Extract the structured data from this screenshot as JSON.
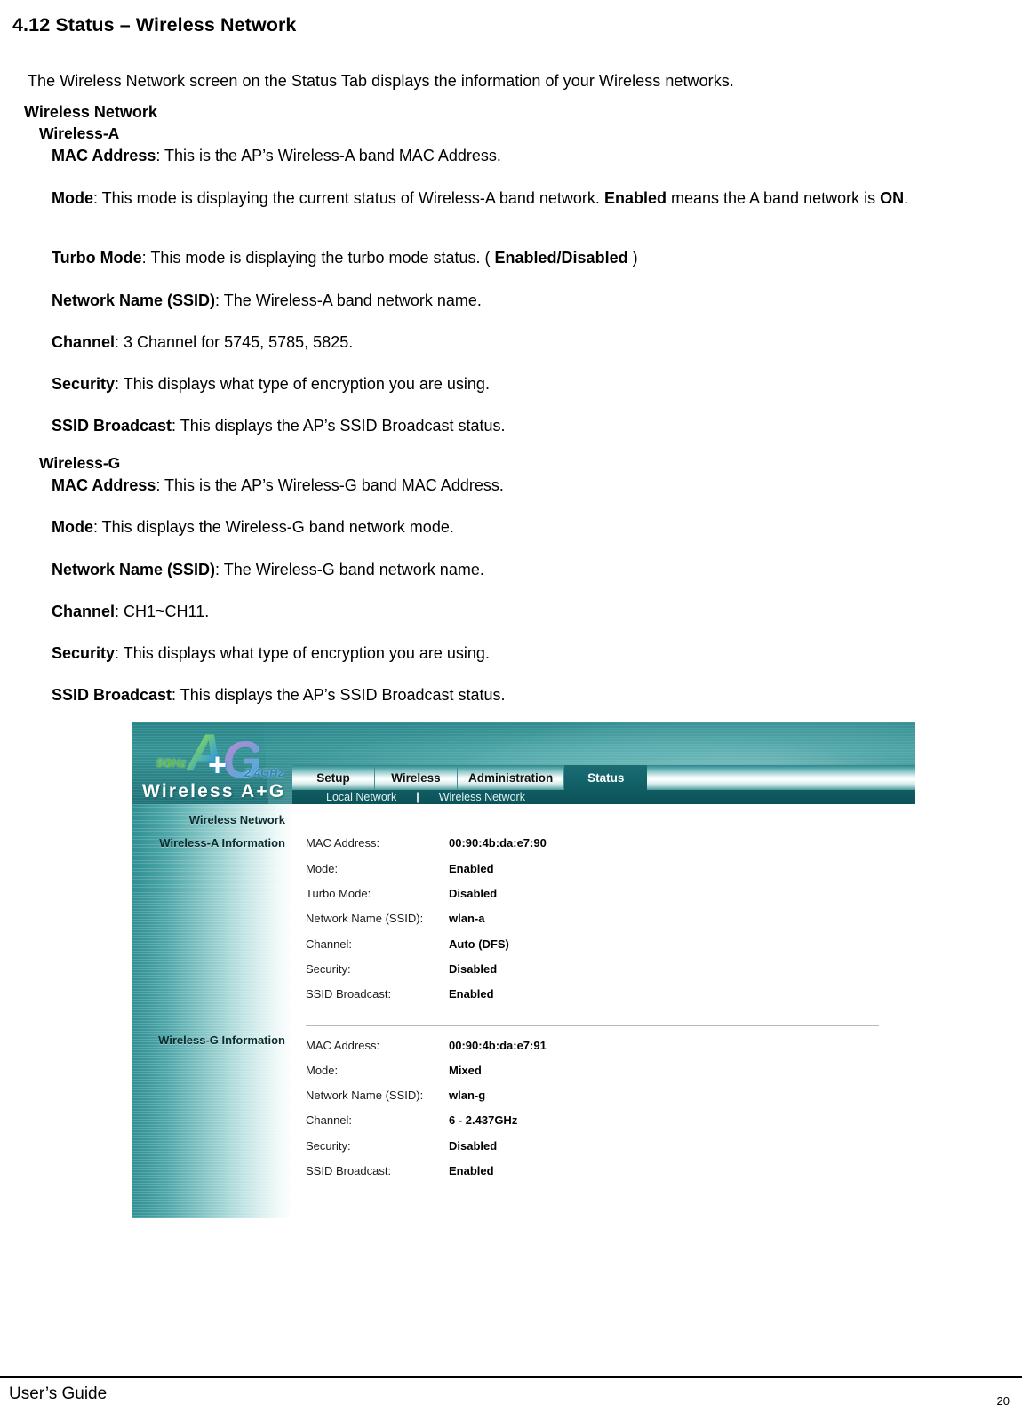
{
  "document": {
    "heading": "4.12 Status – Wireless Network",
    "intro": "The Wireless Network screen on the Status Tab displays the information of your Wireless networks.",
    "section_title": "Wireless Network",
    "subsection_a_title": "Wireless-A",
    "subsection_g_title": "Wireless-G",
    "wireless_a_items": [
      {
        "term": "MAC Address",
        "text": ": This is the AP’s Wireless-A band MAC Address."
      },
      {
        "term": "Mode",
        "text": ": This mode is displaying the current status of Wireless-A band network. ",
        "bold_mid": "Enabled",
        "text2": " means the A band network is ",
        "bold_end": "ON",
        "text3": "."
      },
      {
        "term": "Turbo Mode",
        "text": ": This mode is displaying the turbo mode status. ( ",
        "bold_mid": "Enabled/Disabled",
        "text2": " )"
      },
      {
        "term": "Network Name (SSID)",
        "text": ": The Wireless-A band network name."
      },
      {
        "term": "Channel",
        "text": ": 3 Channel for 5745, 5785, 5825."
      },
      {
        "term": "Security",
        "text": ": This displays what type of encryption you are using."
      },
      {
        "term": "SSID Broadcast",
        "text": ": This displays the AP’s SSID Broadcast status."
      }
    ],
    "wireless_g_items": [
      {
        "term": "MAC Address",
        "text": ": This is the AP’s Wireless-G band MAC Address."
      },
      {
        "term": "Mode",
        "text": ": This displays the Wireless-G band network mode."
      },
      {
        "term": "Network Name (SSID)",
        "text": ": The Wireless-G band network name."
      },
      {
        "term": "Channel",
        "text": ": CH1~CH11."
      },
      {
        "term": "Security",
        "text": ": This displays what type of encryption you are using."
      },
      {
        "term": "SSID Broadcast",
        "text": ": This displays the AP’s SSID Broadcast status."
      }
    ],
    "footer": {
      "left": "User’s Guide",
      "page_number": "20"
    }
  },
  "screenshot": {
    "logo": {
      "letter_a": "A",
      "plus": "+",
      "letter_g": "G",
      "badge_5ghz": "5GHz",
      "badge_24ghz": "2.4GHz",
      "wordmark": "Wireless A+G"
    },
    "tabs": [
      {
        "label": "Setup",
        "active": false
      },
      {
        "label": "Wireless",
        "active": false
      },
      {
        "label": "Administration",
        "active": false
      },
      {
        "label": "Status",
        "active": true
      }
    ],
    "subnav": {
      "items": [
        "Local Network",
        "Wireless Network"
      ],
      "separator": "|"
    },
    "sidebar": {
      "title": "Wireless Network",
      "group_a": "Wireless-A Information",
      "group_g": "Wireless-G Information"
    },
    "wireless_a_rows": [
      {
        "label": "MAC Address:",
        "value": "00:90:4b:da:e7:90"
      },
      {
        "label": "Mode:",
        "value": "Enabled"
      },
      {
        "label": "Turbo Mode:",
        "value": "Disabled"
      },
      {
        "label": "Network Name (SSID):",
        "value": "wlan-a"
      },
      {
        "label": "Channel:",
        "value": "Auto (DFS)"
      },
      {
        "label": "Security:",
        "value": "Disabled"
      },
      {
        "label": "SSID Broadcast:",
        "value": "Enabled"
      }
    ],
    "wireless_g_rows": [
      {
        "label": "MAC Address:",
        "value": "00:90:4b:da:e7:91"
      },
      {
        "label": "Mode:",
        "value": "Mixed"
      },
      {
        "label": "Network Name (SSID):",
        "value": "wlan-g"
      },
      {
        "label": "Channel:",
        "value": "6 - 2.437GHz"
      },
      {
        "label": "Security:",
        "value": "Disabled"
      },
      {
        "label": "SSID Broadcast:",
        "value": "Enabled"
      }
    ],
    "colors": {
      "header_teal": "#2c8a8e",
      "active_tab": "#0f5c62",
      "subnav_bar": "#0f5c62",
      "sidebar_teal": "#2f8f93"
    }
  }
}
